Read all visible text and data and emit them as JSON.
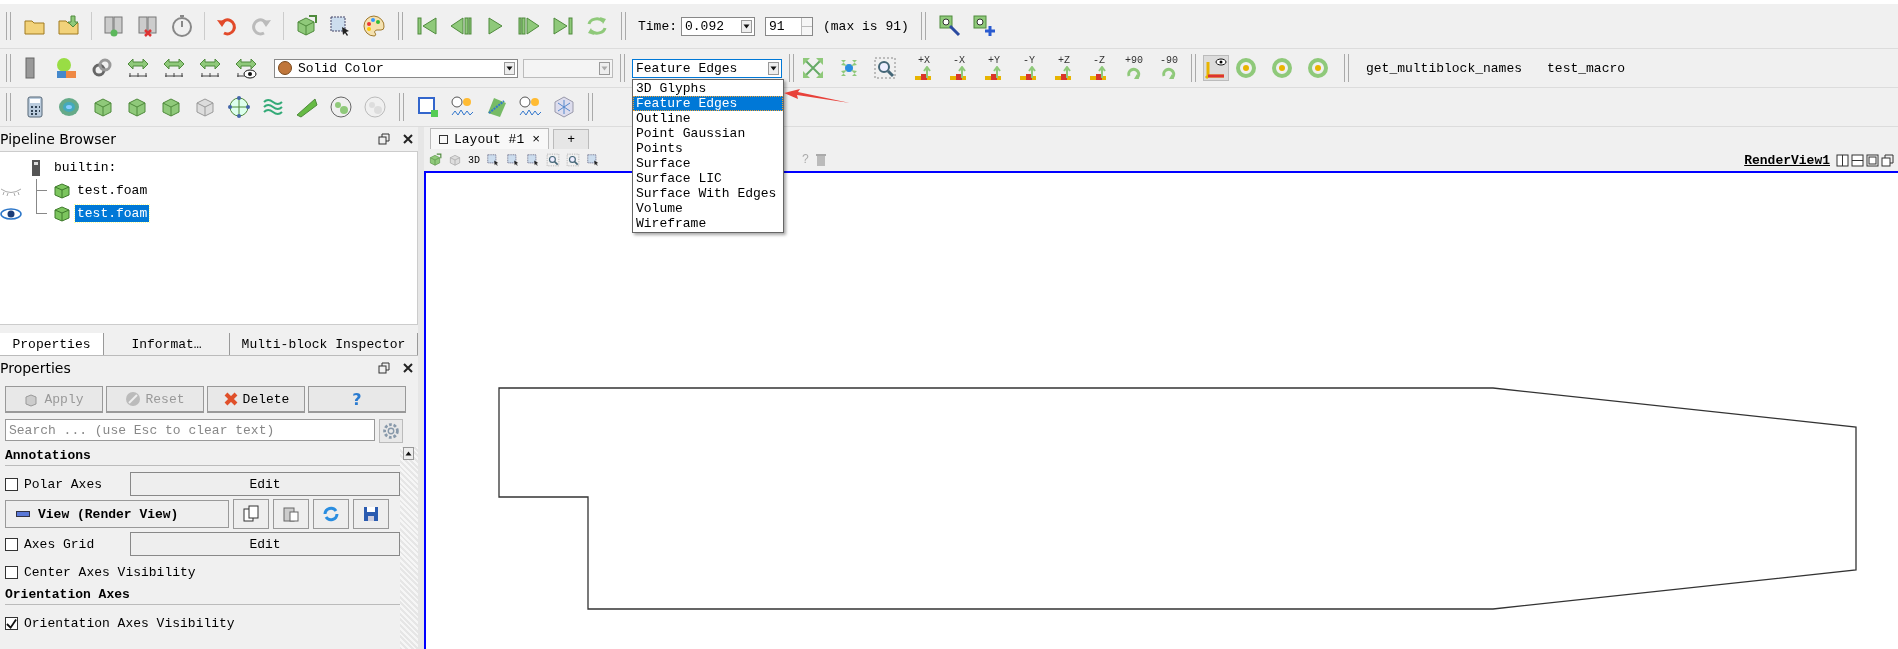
{
  "time_toolbar": {
    "label": "Time:",
    "value": "0.092",
    "step": "91",
    "max_note": "(max is 91)"
  },
  "coloring": {
    "value": "Solid Color"
  },
  "representation": {
    "value": "Feature Edges",
    "expanded": true,
    "options": [
      {
        "label": "3D Glyphs",
        "selected": false
      },
      {
        "label": "Feature Edges",
        "selected": true
      },
      {
        "label": "Outline",
        "selected": false
      },
      {
        "label": "Point Gaussian",
        "selected": false
      },
      {
        "label": "Points",
        "selected": false
      },
      {
        "label": "Surface",
        "selected": false
      },
      {
        "label": "Surface LIC",
        "selected": false
      },
      {
        "label": "Surface With Edges",
        "selected": false
      },
      {
        "label": "Volume",
        "selected": false
      },
      {
        "label": "Wireframe",
        "selected": false
      }
    ]
  },
  "camera_buttons": [
    {
      "label": "+X",
      "kind": "axis"
    },
    {
      "label": "-X",
      "kind": "axis"
    },
    {
      "label": "+Y",
      "kind": "axis"
    },
    {
      "label": "-Y",
      "kind": "axis"
    },
    {
      "label": "+Z",
      "kind": "axis"
    },
    {
      "label": "-Z",
      "kind": "axis"
    },
    {
      "label": "+90",
      "kind": "rotate"
    },
    {
      "label": "-90",
      "kind": "rotate"
    }
  ],
  "macros": [
    "get_multiblock_names",
    "test_macro"
  ],
  "pipeline_browser": {
    "title": "Pipeline Browser",
    "root": {
      "label": "builtin:",
      "children": [
        {
          "label": "test.foam",
          "visible": false,
          "selected": false
        },
        {
          "label": "test.foam",
          "visible": true,
          "selected": true
        }
      ]
    }
  },
  "panel_tabs": [
    {
      "label": "Properties",
      "selected": true
    },
    {
      "label": "Informat…",
      "selected": false
    },
    {
      "label": "Multi-block Inspector",
      "selected": false
    }
  ],
  "properties": {
    "title": "Properties",
    "buttons": [
      {
        "label": "Apply",
        "kind": "apply",
        "disabled": true
      },
      {
        "label": "Reset",
        "kind": "reset",
        "disabled": true
      },
      {
        "label": "Delete",
        "kind": "delete",
        "disabled": false
      },
      {
        "label": "?",
        "kind": "help",
        "disabled": false
      }
    ],
    "search": {
      "placeholder": "Search ... (use Esc to clear text)"
    },
    "rows": [
      {
        "kind": "header",
        "label": "Annotations"
      },
      {
        "kind": "check_edit",
        "label": "Polar Axes",
        "checked": false,
        "button": "Edit"
      },
      {
        "kind": "view",
        "label": "View (Render View)"
      },
      {
        "kind": "check_edit",
        "label": "Axes Grid",
        "checked": false,
        "button": "Edit"
      },
      {
        "kind": "check",
        "label": "Center Axes Visibility",
        "checked": false
      },
      {
        "kind": "header",
        "label": "Orientation Axes"
      },
      {
        "kind": "check",
        "label": "Orientation Axes Visibility",
        "checked": true
      }
    ]
  },
  "layout_tabs": {
    "tabs": [
      {
        "label": "Layout #1",
        "close": "×",
        "selected": true
      }
    ],
    "new_tab": "+"
  },
  "view_toolbar": {
    "mode_3d": "3D",
    "help": "?"
  },
  "render_view": {
    "title": "RenderView1"
  }
}
